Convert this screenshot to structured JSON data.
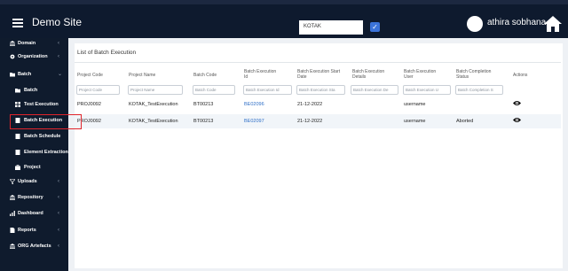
{
  "topbar": {
    "site_title": "Demo Site",
    "org_selector": "KOTAK",
    "user_name": "athira sobhana"
  },
  "sidebar": {
    "items": [
      {
        "label": "Domain",
        "icon": "bank-icon",
        "chevron": "‹"
      },
      {
        "label": "Organization",
        "icon": "gear-icon",
        "chevron": "‹"
      },
      {
        "label": "Batch",
        "icon": "folder-icon",
        "chevron": "⌄"
      },
      {
        "label": "Batch",
        "icon": "folder-icon",
        "chevron": ""
      },
      {
        "label": "Test Execution",
        "icon": "grid-icon",
        "chevron": ""
      },
      {
        "label": "Batch Execution",
        "icon": "file-icon",
        "chevron": ""
      },
      {
        "label": "Batch Schedule",
        "icon": "file-icon",
        "chevron": ""
      },
      {
        "label": "Element Extraction",
        "icon": "file-icon",
        "chevron": ""
      },
      {
        "label": "Project",
        "icon": "briefcase-icon",
        "chevron": ""
      },
      {
        "label": "Uploads",
        "icon": "filter-icon",
        "chevron": "‹"
      },
      {
        "label": "Repository",
        "icon": "bank-icon",
        "chevron": "‹"
      },
      {
        "label": "Dashboard",
        "icon": "bar-chart-icon",
        "chevron": "‹"
      },
      {
        "label": "Reports",
        "icon": "file-icon",
        "chevron": "‹"
      },
      {
        "label": "ORG Artefacts",
        "icon": "bank-icon",
        "chevron": "‹"
      }
    ]
  },
  "main": {
    "panel_title": "List of Batch Execution",
    "columns": [
      {
        "header": "Project Code",
        "filter": "Project Code"
      },
      {
        "header": "Project Name",
        "filter": "Project Name"
      },
      {
        "header": "Batch Code",
        "filter": "Batch Code"
      },
      {
        "header": "Batch Execution Id",
        "filter": "Batch Execution Id"
      },
      {
        "header": "Batch Execution Start Date",
        "filter": "Batch Execution Sta"
      },
      {
        "header": "Batch Execution Details",
        "filter": "Batch Execution De"
      },
      {
        "header": "Batch Execution User",
        "filter": "Batch Execution U"
      },
      {
        "header": "Batch Completion Status",
        "filter": "Batch Completion S"
      },
      {
        "header": "Actions",
        "filter": ""
      }
    ],
    "rows": [
      {
        "project_code": "PROJ0092",
        "project_name": "KOTAK_TestExecution",
        "batch_code": "BT00213",
        "execution_id": "BE02096",
        "start_date": "21-12-2022",
        "details": "",
        "user": "username",
        "status": ""
      },
      {
        "project_code": "PROJ0092",
        "project_name": "KOTAK_TestExecution",
        "batch_code": "BT00213",
        "execution_id": "BE02097",
        "start_date": "21-12-2022",
        "details": "",
        "user": "username",
        "status": "Aborted"
      }
    ]
  }
}
